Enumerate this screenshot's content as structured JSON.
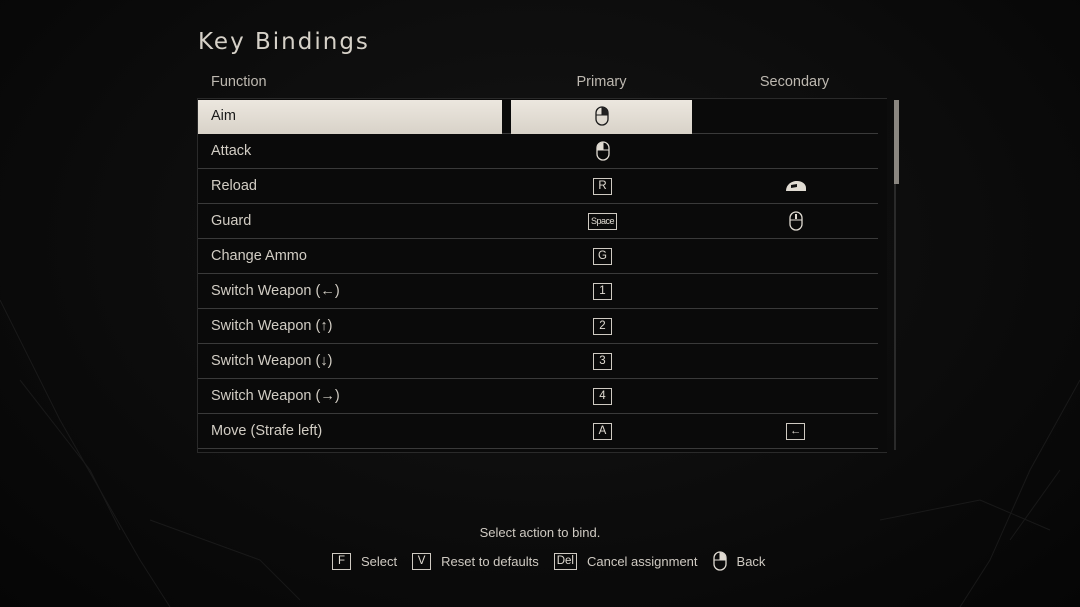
{
  "screen": {
    "title": "Key Bindings",
    "columns": {
      "function": "Function",
      "primary": "Primary",
      "secondary": "Secondary"
    }
  },
  "bindings": [
    {
      "function": "Aim",
      "primary": {
        "icon": "mouse-right-icon"
      },
      "secondary": null,
      "selected": true
    },
    {
      "function": "Attack",
      "primary": {
        "icon": "mouse-left-icon"
      },
      "secondary": null
    },
    {
      "function": "Reload",
      "primary": {
        "key": "R"
      },
      "secondary": {
        "icon": "mouse-side-icon"
      }
    },
    {
      "function": "Guard",
      "primary": {
        "key": "Space"
      },
      "secondary": {
        "icon": "mouse-middle-icon"
      }
    },
    {
      "function": "Change Ammo",
      "primary": {
        "key": "G"
      },
      "secondary": null
    },
    {
      "function": "Switch Weapon (←)",
      "primary": {
        "key": "1"
      },
      "secondary": null
    },
    {
      "function": "Switch Weapon (↑)",
      "primary": {
        "key": "2"
      },
      "secondary": null
    },
    {
      "function": "Switch Weapon (↓)",
      "primary": {
        "key": "3"
      },
      "secondary": null
    },
    {
      "function": "Switch Weapon (→)",
      "primary": {
        "key": "4"
      },
      "secondary": null
    },
    {
      "function": "Move (Strafe left)",
      "primary": {
        "key": "A"
      },
      "secondary": {
        "key": "←"
      }
    }
  ],
  "footer": {
    "hint": "Select action to bind.",
    "actions": [
      {
        "key": "F",
        "label": "Select"
      },
      {
        "key": "V",
        "label": "Reset to defaults"
      },
      {
        "key": "Del",
        "label": "Cancel assignment"
      },
      {
        "icon": "mouse-right-icon",
        "label": "Back"
      }
    ]
  },
  "colors": {
    "background": "#0c0c0c",
    "selection": "#e6e1d8",
    "text": "#d2cdc4",
    "divider": "#3a3a3a"
  },
  "scrollbar": {
    "visible_fraction": 0.24
  }
}
